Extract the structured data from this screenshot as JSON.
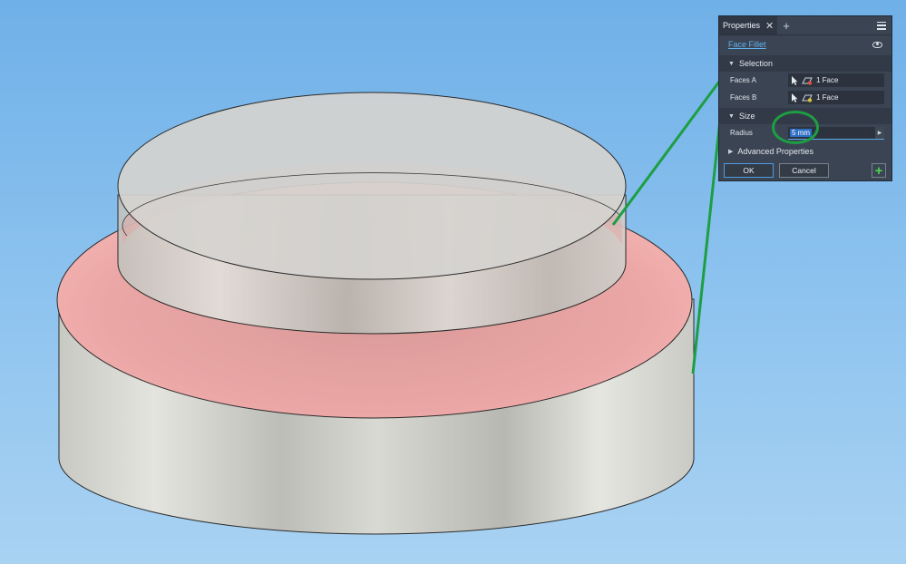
{
  "panel": {
    "tab_title": "Properties",
    "tab_close": "✕",
    "tab_add": "+",
    "feature_name": "Face Fillet",
    "sections": {
      "selection": "Selection",
      "size": "Size",
      "advanced": "Advanced Properties"
    },
    "faces_a": {
      "label": "Faces A",
      "value": "1 Face"
    },
    "faces_b": {
      "label": "Faces B",
      "value": "1 Face"
    },
    "radius": {
      "label": "Radius",
      "value": "5 mm"
    },
    "buttons": {
      "ok": "OK",
      "cancel": "Cancel",
      "add": "+"
    }
  },
  "colors": {
    "panel_bg": "#3b4453",
    "accent_link": "#5fb2f0",
    "annotation_green": "#1d9e43",
    "fillet_highlight": "#f2a0a0",
    "model_surface": "#d8d8d4"
  },
  "icons": [
    "close-icon",
    "plus-icon",
    "hamburger-menu-icon",
    "eye-icon",
    "cursor-arrow-icon",
    "face-select-icon",
    "triangle-down-icon",
    "triangle-right-icon",
    "dropdown-arrow-icon"
  ]
}
